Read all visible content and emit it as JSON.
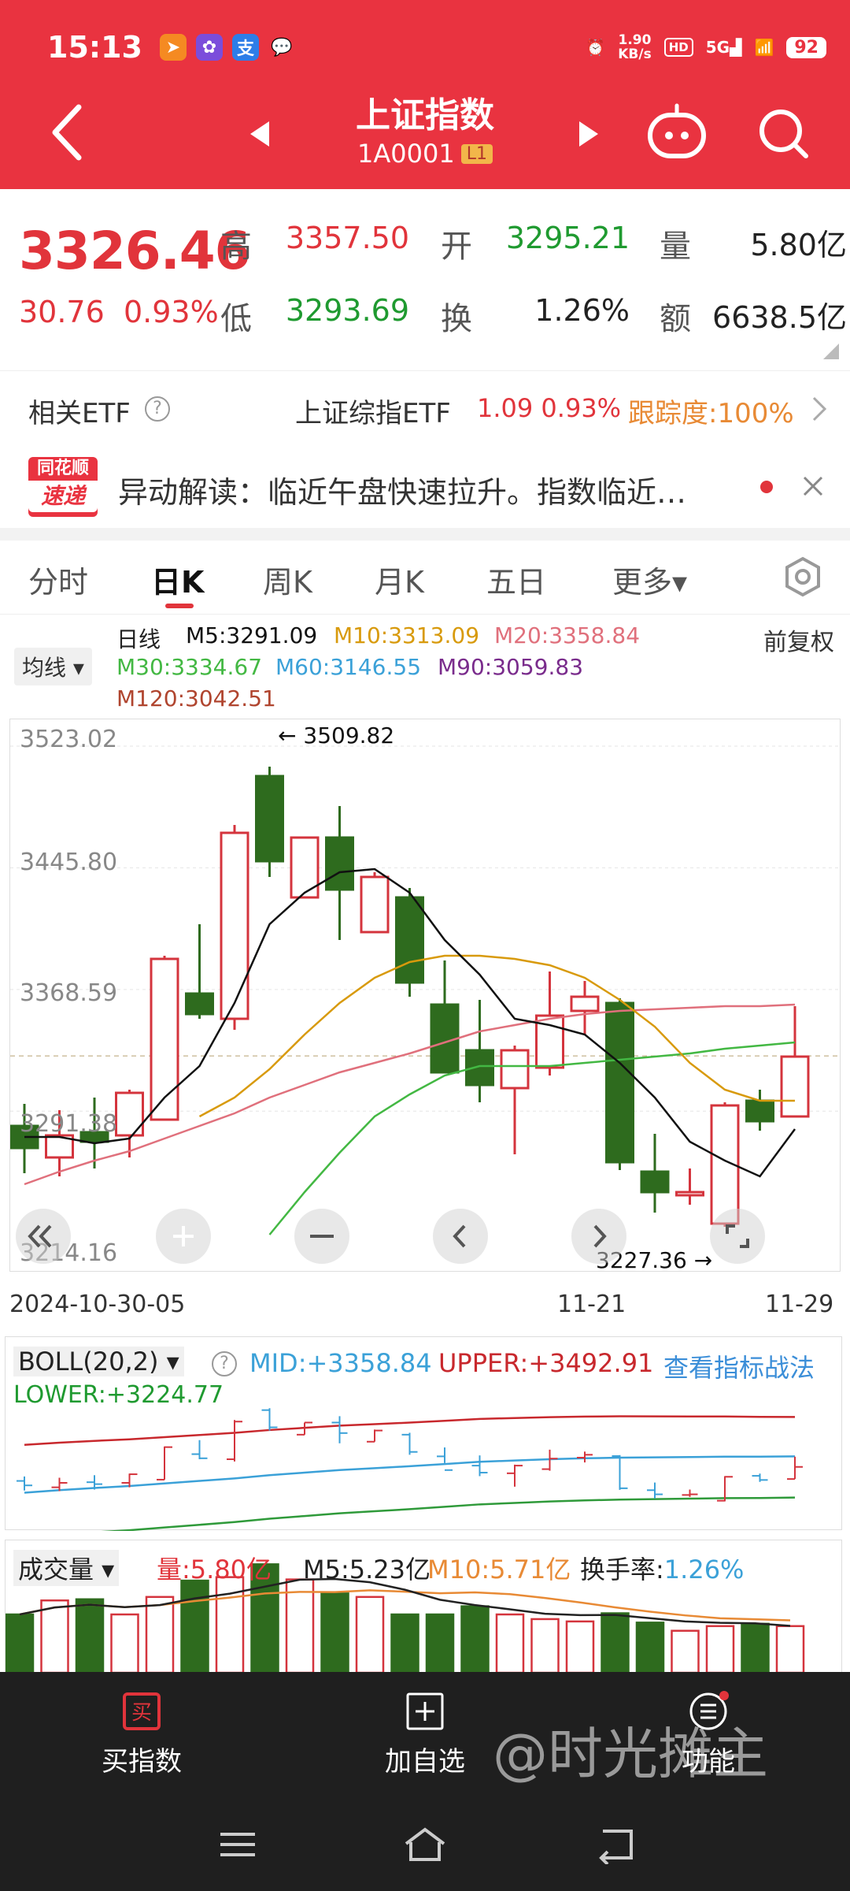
{
  "status": {
    "time": "15:13",
    "speed_top": "1.90",
    "speed_unit": "KB/s",
    "hd": "HD",
    "net": "5G",
    "battery": "92"
  },
  "header": {
    "title": "上证指数",
    "code": "1A0001",
    "badge": "L1"
  },
  "quote": {
    "price": "3326.46",
    "change": "30.76",
    "change_pct": "0.93%",
    "high_label": "高",
    "high": "3357.50",
    "open_label": "开",
    "open": "3295.21",
    "vol_label": "量",
    "volume": "5.80亿",
    "low_label": "低",
    "low": "3293.69",
    "turn_label": "换",
    "turnover_rate": "1.26%",
    "amt_label": "额",
    "amount": "6638.5亿"
  },
  "etf": {
    "label": "相关ETF",
    "name": "上证综指ETF",
    "value": "1.09 0.93%",
    "tracking": "跟踪度:100%"
  },
  "news": {
    "logo_top": "同花顺",
    "logo_bottom": "速递",
    "text": "异动解读：临近午盘快速拉升。指数临近…"
  },
  "tabs": [
    "分时",
    "日K",
    "周K",
    "月K",
    "五日",
    "更多▾"
  ],
  "ma_legend": {
    "selector": "均线 ▾",
    "period": "日线",
    "adjust": "前复权",
    "m5": "M5:3291.09",
    "m10": "M10:3313.09",
    "m20": "M20:3358.84",
    "m30": "M30:3334.67",
    "m60": "M60:3146.55",
    "m90": "M90:3059.83",
    "m120": "M120:3042.51",
    "colors": {
      "m5": "#111111",
      "m10": "#d89a0c",
      "m20": "#e0707c",
      "m30": "#43b843",
      "m60": "#3ba1d8",
      "m90": "#7a2c8c",
      "m120": "#b0452f"
    }
  },
  "kchart": {
    "y_labels": [
      "3523.02",
      "3445.80",
      "3368.59",
      "3291.38",
      "3214.16"
    ],
    "high_mark": "3509.82",
    "low_mark": "3227.36",
    "x_labels": [
      "2024-10-30-05",
      "11-21",
      "11-29"
    ],
    "up_color": "#d4343d",
    "down_color": "#2e6b1e"
  },
  "chart_data": {
    "type": "candlestick",
    "ylim": [
      3200,
      3530
    ],
    "candles": [
      {
        "o": 3282,
        "h": 3296,
        "l": 3252,
        "c": 3268
      },
      {
        "o": 3262,
        "h": 3292,
        "l": 3250,
        "c": 3276
      },
      {
        "o": 3278,
        "h": 3300,
        "l": 3255,
        "c": 3272
      },
      {
        "o": 3276,
        "h": 3305,
        "l": 3262,
        "c": 3303
      },
      {
        "o": 3286,
        "h": 3390,
        "l": 3286,
        "c": 3388
      },
      {
        "o": 3366,
        "h": 3410,
        "l": 3350,
        "c": 3353
      },
      {
        "o": 3350,
        "h": 3473,
        "l": 3343,
        "c": 3468
      },
      {
        "o": 3504,
        "h": 3510,
        "l": 3440,
        "c": 3450
      },
      {
        "o": 3427,
        "h": 3465,
        "l": 3427,
        "c": 3465
      },
      {
        "o": 3465,
        "h": 3485,
        "l": 3400,
        "c": 3432
      },
      {
        "o": 3405,
        "h": 3443,
        "l": 3405,
        "c": 3440
      },
      {
        "o": 3427,
        "h": 3433,
        "l": 3364,
        "c": 3373
      },
      {
        "o": 3359,
        "h": 3387,
        "l": 3338,
        "c": 3316
      },
      {
        "o": 3330,
        "h": 3362,
        "l": 3297,
        "c": 3308
      },
      {
        "o": 3306,
        "h": 3333,
        "l": 3264,
        "c": 3330
      },
      {
        "o": 3319,
        "h": 3380,
        "l": 3314,
        "c": 3352
      },
      {
        "o": 3355,
        "h": 3374,
        "l": 3340,
        "c": 3364
      },
      {
        "o": 3360,
        "h": 3363,
        "l": 3254,
        "c": 3259
      },
      {
        "o": 3253,
        "h": 3277,
        "l": 3227,
        "c": 3240
      },
      {
        "o": 3238,
        "h": 3255,
        "l": 3232,
        "c": 3240
      },
      {
        "o": 3220,
        "h": 3297,
        "l": 3218,
        "c": 3295
      },
      {
        "o": 3298,
        "h": 3305,
        "l": 3279,
        "c": 3285
      },
      {
        "o": 3288,
        "h": 3358,
        "l": 3288,
        "c": 3326
      }
    ],
    "ma5": [
      3275,
      3275,
      3271,
      3274,
      3300,
      3320,
      3360,
      3410,
      3430,
      3443,
      3445,
      3430,
      3400,
      3378,
      3350,
      3346,
      3340,
      3322,
      3300,
      3272,
      3260,
      3250,
      3280
    ],
    "ma10": [
      null,
      null,
      null,
      null,
      null,
      3288,
      3300,
      3318,
      3340,
      3360,
      3376,
      3386,
      3390,
      3390,
      3388,
      3384,
      3376,
      3362,
      3345,
      3322,
      3305,
      3298,
      3298
    ],
    "ma20": [
      3245,
      3253,
      3260,
      3266,
      3274,
      3282,
      3290,
      3300,
      3308,
      3316,
      3322,
      3328,
      3335,
      3342,
      3346,
      3350,
      3353,
      3355,
      3356,
      3357,
      3358,
      3358,
      3359
    ],
    "ma30": [
      null,
      null,
      null,
      null,
      null,
      null,
      null,
      3213,
      3240,
      3265,
      3288,
      3302,
      3314,
      3320,
      3320,
      3320,
      3322,
      3324,
      3326,
      3328,
      3331,
      3333,
      3335
    ]
  },
  "boll": {
    "name": "BOLL(20,2) ▾",
    "mid": "MID:+3358.84",
    "upper": "UPPER:+3492.91",
    "link": "查看指标战法",
    "lower": "LOWER:+3224.77"
  },
  "volume": {
    "name": "成交量 ▾",
    "vol": "量:5.80亿",
    "m5": "M5:5.23亿",
    "m10": "M10:5.71亿",
    "turnover_label": "换手率:",
    "turnover": "1.26%",
    "bars": [
      5.0,
      6.2,
      6.3,
      5.0,
      6.5,
      7.9,
      8.2,
      9.3,
      8.0,
      6.8,
      6.5,
      5.0,
      5.0,
      5.7,
      5.0,
      4.6,
      4.4,
      5.1,
      4.3,
      3.6,
      4.0,
      4.2,
      4.0
    ]
  },
  "bottom": {
    "buy": "买指数",
    "add": "加自选",
    "func": "功能",
    "watermark": "@时光摊主"
  }
}
